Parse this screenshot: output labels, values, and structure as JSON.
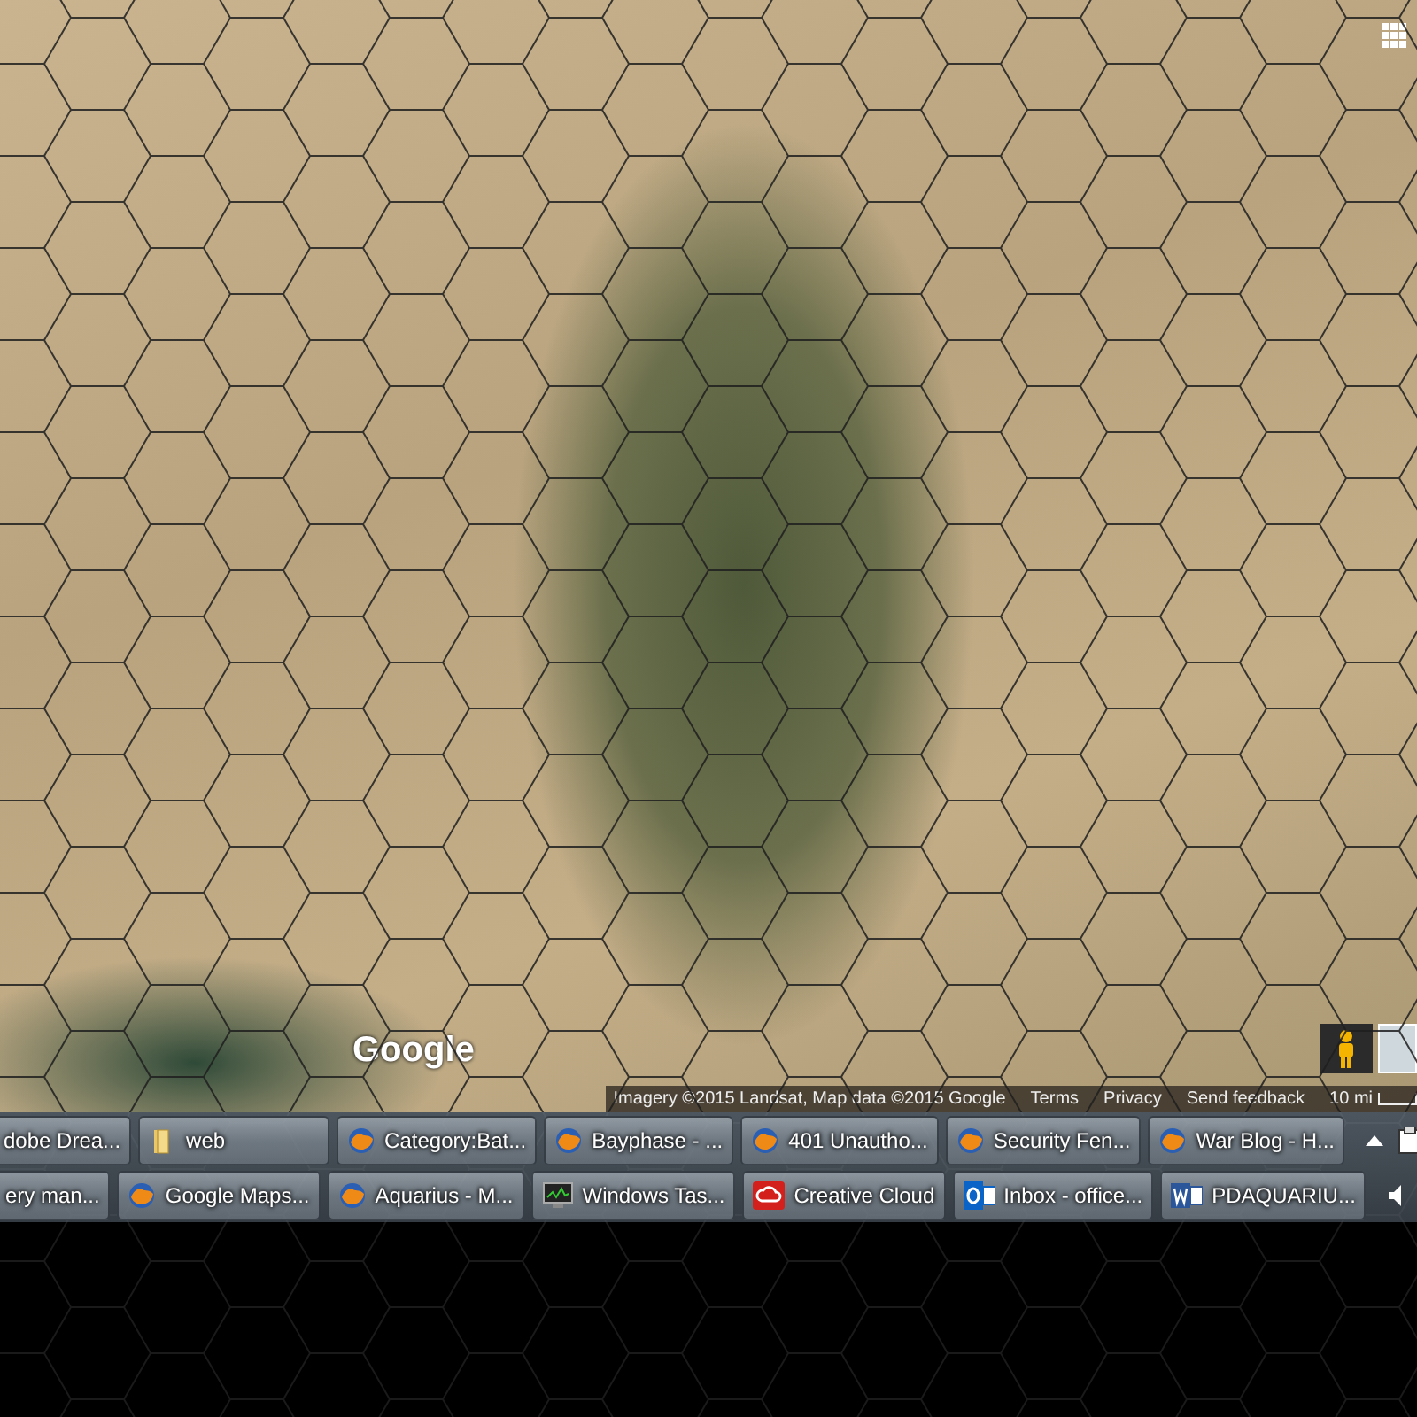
{
  "map": {
    "logo": "Google",
    "attribution": {
      "imagery": "Imagery ©2015 Landsat, Map data ©2015 Google",
      "links": [
        "Terms",
        "Privacy",
        "Send feedback"
      ],
      "scale": "10 mi"
    }
  },
  "taskbar": {
    "rows": [
      [
        {
          "label": "dobe Drea...",
          "kind": "cut"
        },
        {
          "label": "web",
          "kind": "folder"
        },
        {
          "label": "Category:Bat...",
          "kind": "browser"
        },
        {
          "label": "Bayphase - ...",
          "kind": "browser"
        },
        {
          "label": "401 Unautho...",
          "kind": "browser"
        },
        {
          "label": "Security Fen...",
          "kind": "browser"
        },
        {
          "label": "War Blog - H...",
          "kind": "browser"
        }
      ],
      [
        {
          "label": "ery man...",
          "kind": "cut"
        },
        {
          "label": "Google Maps...",
          "kind": "browser"
        },
        {
          "label": "Aquarius - M...",
          "kind": "browser"
        },
        {
          "label": "Windows Tas...",
          "kind": "monitor"
        },
        {
          "label": "Creative Cloud",
          "kind": "cloud"
        },
        {
          "label": "Inbox - office...",
          "kind": "mail"
        },
        {
          "label": "PDAQUARIU...",
          "kind": "document"
        }
      ]
    ]
  }
}
